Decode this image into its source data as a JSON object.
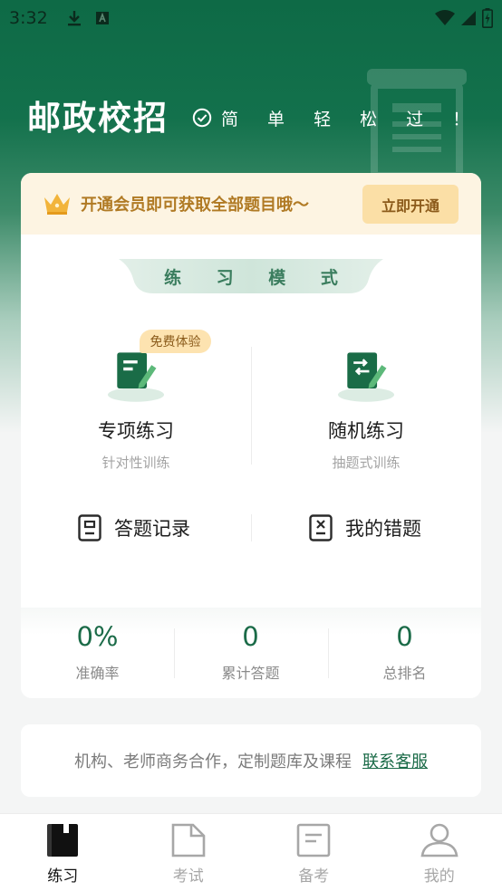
{
  "status_bar": {
    "time": "3:32"
  },
  "header": {
    "title": "邮政校招",
    "slogan": "简 单 轻 松 过 ！"
  },
  "vip": {
    "text": "开通会员即可获取全部题目哦～",
    "button_label": "立即开通"
  },
  "practice": {
    "section_title": "练 习 模 式",
    "modes": [
      {
        "name": "专项练习",
        "subtitle": "针对性训练",
        "badge": "免费体验"
      },
      {
        "name": "随机练习",
        "subtitle": "抽题式训练"
      }
    ],
    "links": [
      {
        "label": "答题记录"
      },
      {
        "label": "我的错题"
      }
    ]
  },
  "stats": [
    {
      "value": "0%",
      "label": "准确率"
    },
    {
      "value": "0",
      "label": "累计答题"
    },
    {
      "value": "0",
      "label": "总排名"
    }
  ],
  "contact": {
    "text": "机构、老师商务合作，定制题库及课程",
    "link": "联系客服"
  },
  "tabs": [
    {
      "label": "练习",
      "icon": "book-icon",
      "active": true
    },
    {
      "label": "考试",
      "icon": "document-icon",
      "active": false
    },
    {
      "label": "备考",
      "icon": "notes-icon",
      "active": false
    },
    {
      "label": "我的",
      "icon": "person-icon",
      "active": false
    }
  ],
  "colors": {
    "brand_green": "#0e6a46",
    "accent_green": "#1b6b48",
    "gold": "#b07a24",
    "badge_bg": "#fde3b0"
  }
}
